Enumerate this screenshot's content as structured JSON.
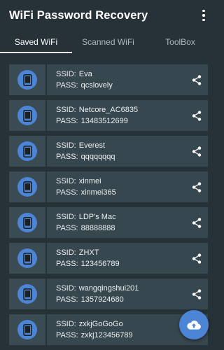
{
  "appbar": {
    "title": "WiFi Password Recovery",
    "menu_icon": "more-vert-icon"
  },
  "tabs": [
    {
      "label": "Saved WiFi",
      "active": true
    },
    {
      "label": "Scanned WiFi",
      "active": false
    },
    {
      "label": "ToolBox",
      "active": false
    }
  ],
  "labels": {
    "ssid": "SSID:",
    "pass": "PASS:"
  },
  "networks": [
    {
      "ssid": "Eva",
      "pass": "qcslovely"
    },
    {
      "ssid": "Netcore_AC6835",
      "pass": "13483512699"
    },
    {
      "ssid": "Everest",
      "pass": "qqqqqqqq"
    },
    {
      "ssid": "xinmei",
      "pass": "xinmei365"
    },
    {
      "ssid": "LDP's Mac",
      "pass": "88888888"
    },
    {
      "ssid": "ZHXT",
      "pass": "123456789"
    },
    {
      "ssid": "wangqingshui201",
      "pass": "1357924680"
    },
    {
      "ssid": "zxkjGoGoGo",
      "pass": "zxkj123456789"
    }
  ],
  "icons": {
    "network": "phone-icon",
    "share": "share-icon",
    "fab": "cloud-upload-icon"
  },
  "colors": {
    "background": "#263238",
    "card": "#37474f",
    "accent": "#4c84d6",
    "text": "#ffffff"
  }
}
